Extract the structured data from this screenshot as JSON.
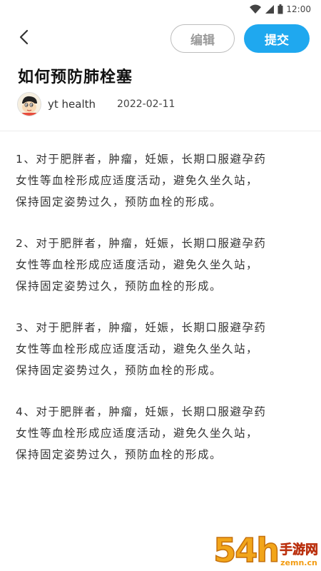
{
  "status_bar": {
    "time": "12:00",
    "icons": [
      "wifi-icon",
      "signal-icon",
      "battery-icon"
    ]
  },
  "toolbar": {
    "back_icon": "chevron-left-icon",
    "edit_label": "编辑",
    "submit_label": "提交"
  },
  "article": {
    "title": "如何预防肺栓塞",
    "author": "yt health",
    "date": "2022-02-11",
    "paragraphs": [
      {
        "lines": [
          "1、对于肥胖者，肿瘤，妊娠，长期口服避孕药",
          "女性等血栓形成应适度活动，避免久坐久站，",
          "保持固定姿势过久，预防血栓的形成。"
        ]
      },
      {
        "lines": [
          "2、对于肥胖者，肿瘤，妊娠，长期口服避孕药",
          "女性等血栓形成应适度活动，避免久坐久站，",
          "保持固定姿势过久，预防血栓的形成。"
        ]
      },
      {
        "lines": [
          "3、对于肥胖者，肿瘤，妊娠，长期口服避孕药",
          "女性等血栓形成应适度活动，避免久坐久站，",
          "保持固定姿势过久，预防血栓的形成。"
        ]
      },
      {
        "lines": [
          "4、对于肥胖者，肿瘤，妊娠，长期口服避孕药",
          "女性等血栓形成应适度活动，避免久坐久站，",
          "保持固定姿势过久，预防血栓的形成。"
        ]
      }
    ]
  },
  "watermark": {
    "big": "54h",
    "cn": "手游网",
    "url": "zemn.cn"
  },
  "colors": {
    "accent": "#1fa8ef",
    "edit_border": "#bdbdbd",
    "watermark_orange": "#f2a51a",
    "watermark_red": "#e8421a"
  }
}
